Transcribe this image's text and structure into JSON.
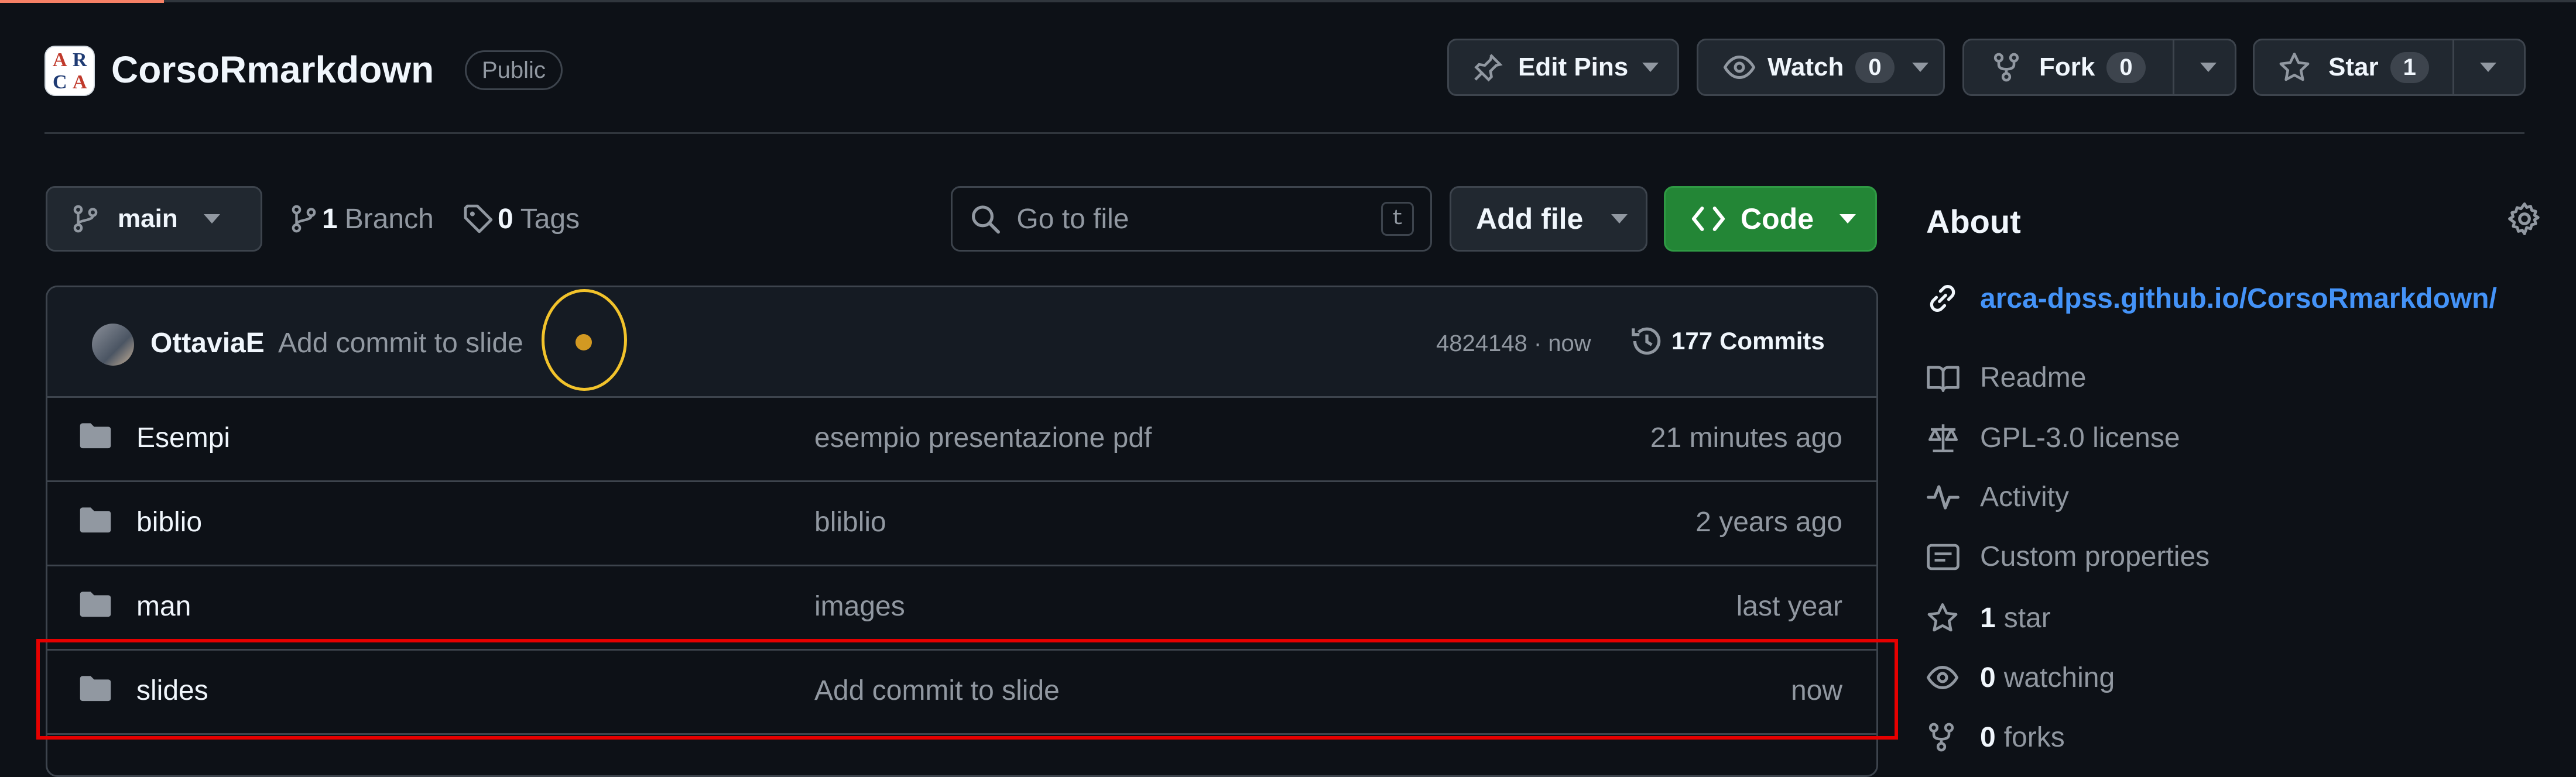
{
  "repo": {
    "logo_letters": [
      "A",
      "R",
      "C",
      "A"
    ],
    "name": "CorsoRmarkdown",
    "visibility": "Public"
  },
  "actions": {
    "edit_pins": "Edit Pins",
    "watch_label": "Watch",
    "watch_count": "0",
    "fork_label": "Fork",
    "fork_count": "0",
    "star_label": "Star",
    "star_count": "1"
  },
  "toolbar": {
    "branch": "main",
    "branches_count": "1",
    "branches_label": "Branch",
    "tags_count": "0",
    "tags_label": "Tags",
    "search_placeholder": "Go to file",
    "search_shortcut": "t",
    "add_file": "Add file",
    "code": "Code"
  },
  "latest_commit": {
    "author": "OttaviaE",
    "message": "Add commit to slide",
    "hash_time": "4824148 · now",
    "commits_count": "177",
    "commits_label": "Commits"
  },
  "files": [
    {
      "name": "Esempi",
      "message": "esempio presentazione pdf",
      "time": "21 minutes ago"
    },
    {
      "name": "biblio",
      "message": "bliblio",
      "time": "2 years ago"
    },
    {
      "name": "man",
      "message": "images",
      "time": "last year"
    },
    {
      "name": "slides",
      "message": "Add commit to slide",
      "time": "now"
    }
  ],
  "about": {
    "title": "About",
    "link": "arca-dpss.github.io/CorsoRmarkdown/",
    "readme": "Readme",
    "license": "GPL-3.0 license",
    "activity": "Activity",
    "custom_properties": "Custom properties",
    "stars_count": "1",
    "stars_label": "star",
    "watching_count": "0",
    "watching_label": "watching",
    "forks_count": "0",
    "forks_label": "forks"
  },
  "colors": {
    "primary_button": "#238636",
    "link": "#4493f8",
    "highlight_box": "#e60000",
    "highlight_circle": "#f2c32b"
  }
}
